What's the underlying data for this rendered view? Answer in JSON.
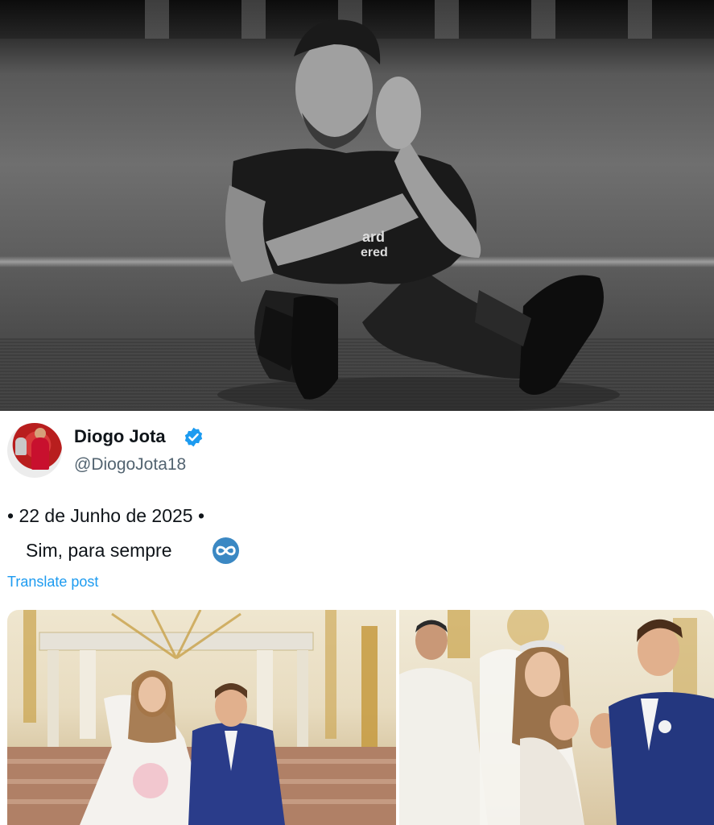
{
  "hero_image": {
    "description_icon": "player-photo"
  },
  "tweet": {
    "display_name": "Diogo Jota",
    "handle": "@DiogoJota18",
    "verified": true,
    "date_line": "• 22 de Junho de 2025 •",
    "text": "Sim, para sempre",
    "translate_label": "Translate post"
  },
  "colors": {
    "link": "#1d9bf0",
    "verified": "#1d9bf0",
    "text_primary": "#0f1419",
    "text_secondary": "#536471"
  },
  "icons": {
    "verified": "verified-badge-icon",
    "emoji": "infinity-emoji-icon"
  }
}
